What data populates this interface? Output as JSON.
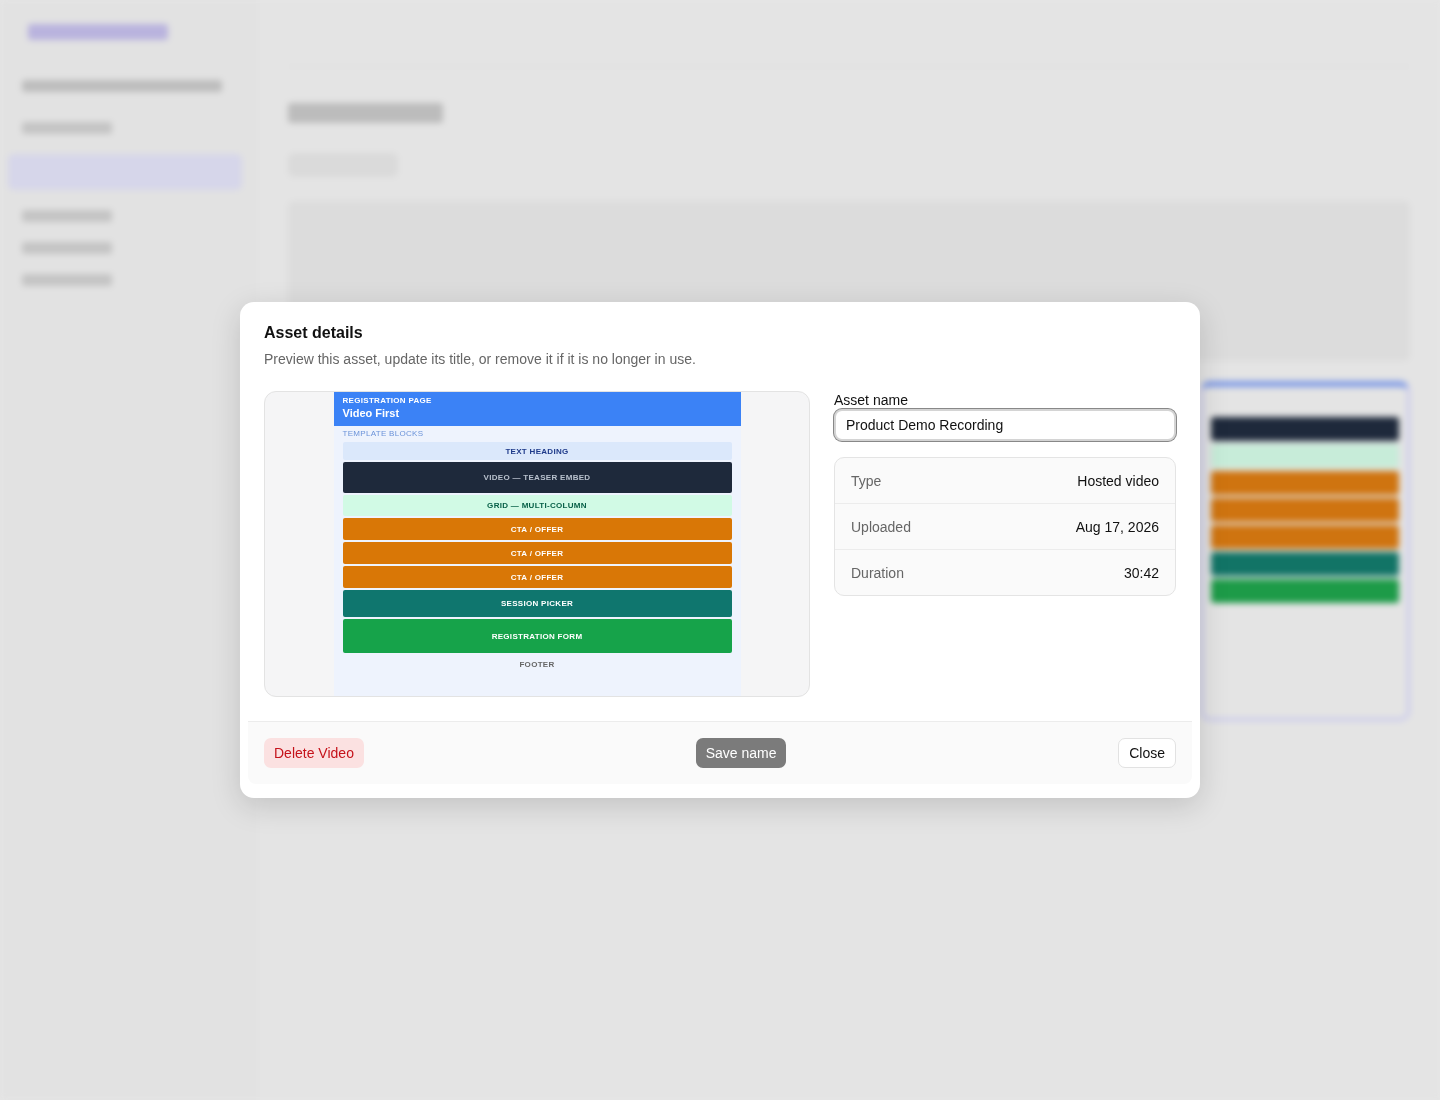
{
  "dialog": {
    "title": "Asset details",
    "description": "Preview this asset, update its title, or remove it if it is no longer in use.",
    "preview": {
      "eyebrow": "REGISTRATION PAGE",
      "title": "Video First",
      "section_label": "TEMPLATE BLOCKS",
      "blocks": [
        {
          "kind": "heading",
          "label": "TEXT HEADING"
        },
        {
          "kind": "video",
          "label": "VIDEO — TEASER EMBED"
        },
        {
          "kind": "grid",
          "label": "GRID — MULTI-COLUMN"
        },
        {
          "kind": "cta",
          "label": "CTA / OFFER"
        },
        {
          "kind": "cta",
          "label": "CTA / OFFER"
        },
        {
          "kind": "cta",
          "label": "CTA / OFFER"
        },
        {
          "kind": "session",
          "label": "SESSION PICKER"
        },
        {
          "kind": "form",
          "label": "REGISTRATION FORM"
        },
        {
          "kind": "footer",
          "label": "FOOTER"
        }
      ]
    },
    "name_field": {
      "label": "Asset name",
      "value": "Product Demo Recording"
    },
    "details": [
      {
        "label": "Type",
        "value": "Hosted video"
      },
      {
        "label": "Uploaded",
        "value": "Aug 17, 2026"
      },
      {
        "label": "Duration",
        "value": "30:42"
      }
    ],
    "buttons": [
      {
        "kind": "danger",
        "label": "Delete Video",
        "disabled": false
      },
      {
        "kind": "primary",
        "label": "Save name",
        "disabled": true
      },
      {
        "kind": "plain",
        "label": "Close",
        "disabled": false
      }
    ]
  }
}
